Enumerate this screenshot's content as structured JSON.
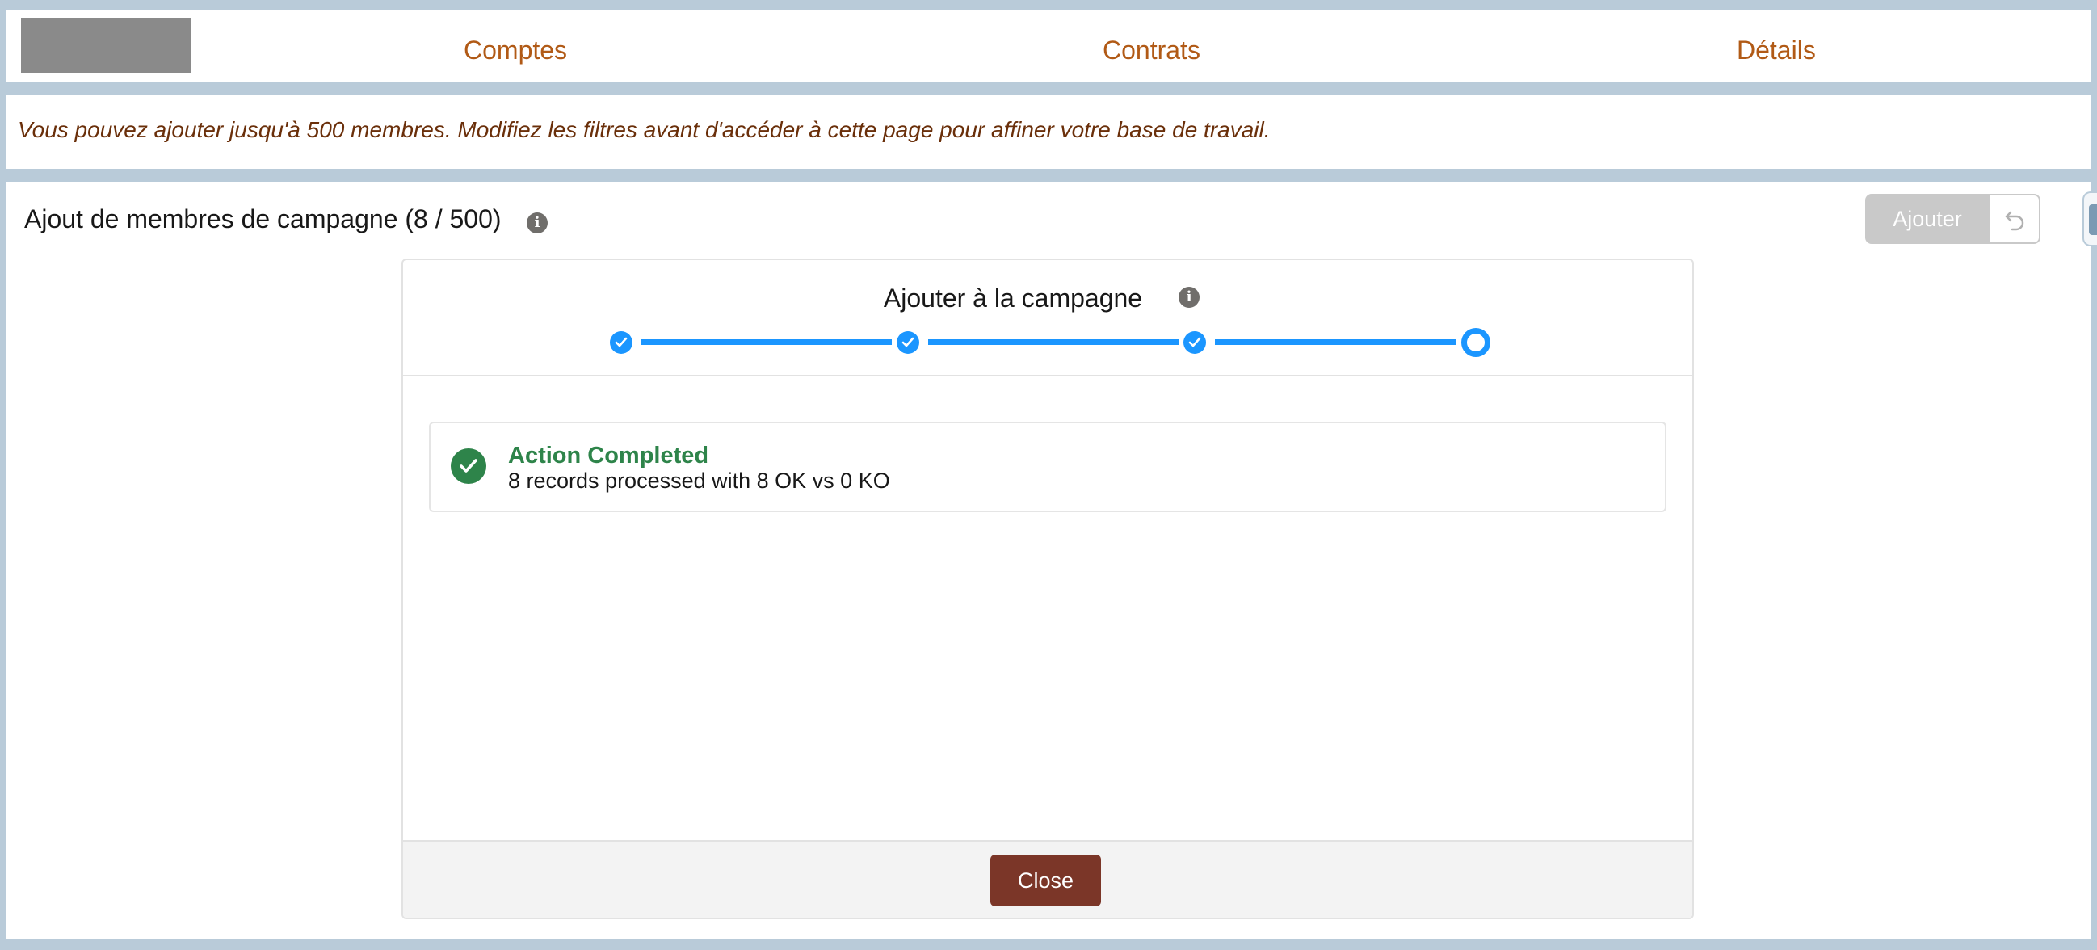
{
  "nav": {
    "items": [
      {
        "label": "Comptes"
      },
      {
        "label": "Contrats"
      },
      {
        "label": "Détails"
      }
    ]
  },
  "info_message": "Vous pouvez ajouter jusqu'à 500 membres. Modifiez les filtres avant d'accéder à cette page pour affiner votre base de travail.",
  "main": {
    "title": "Ajout de membres de campagne (8 / 500)",
    "info_icon": "info-icon",
    "add_button_label": "Ajouter",
    "add_button_state": "disabled",
    "undo_icon": "undo-icon"
  },
  "wizard": {
    "title": "Ajouter à la campagne",
    "steps": [
      {
        "status": "completed"
      },
      {
        "status": "completed"
      },
      {
        "status": "completed"
      },
      {
        "status": "current"
      }
    ],
    "result": {
      "title": "Action Completed",
      "detail": "8 records processed with 8 OK vs 0 KO",
      "icon": "success-check-icon"
    },
    "close_label": "Close"
  },
  "colors": {
    "page_background": "#b9cbd9",
    "nav_link": "#b15a16",
    "info_text": "#6a2f0a",
    "progress": "#1b96ff",
    "success": "#2e844a",
    "close_button": "#7b3628",
    "disabled_button": "#c9c9c9"
  }
}
